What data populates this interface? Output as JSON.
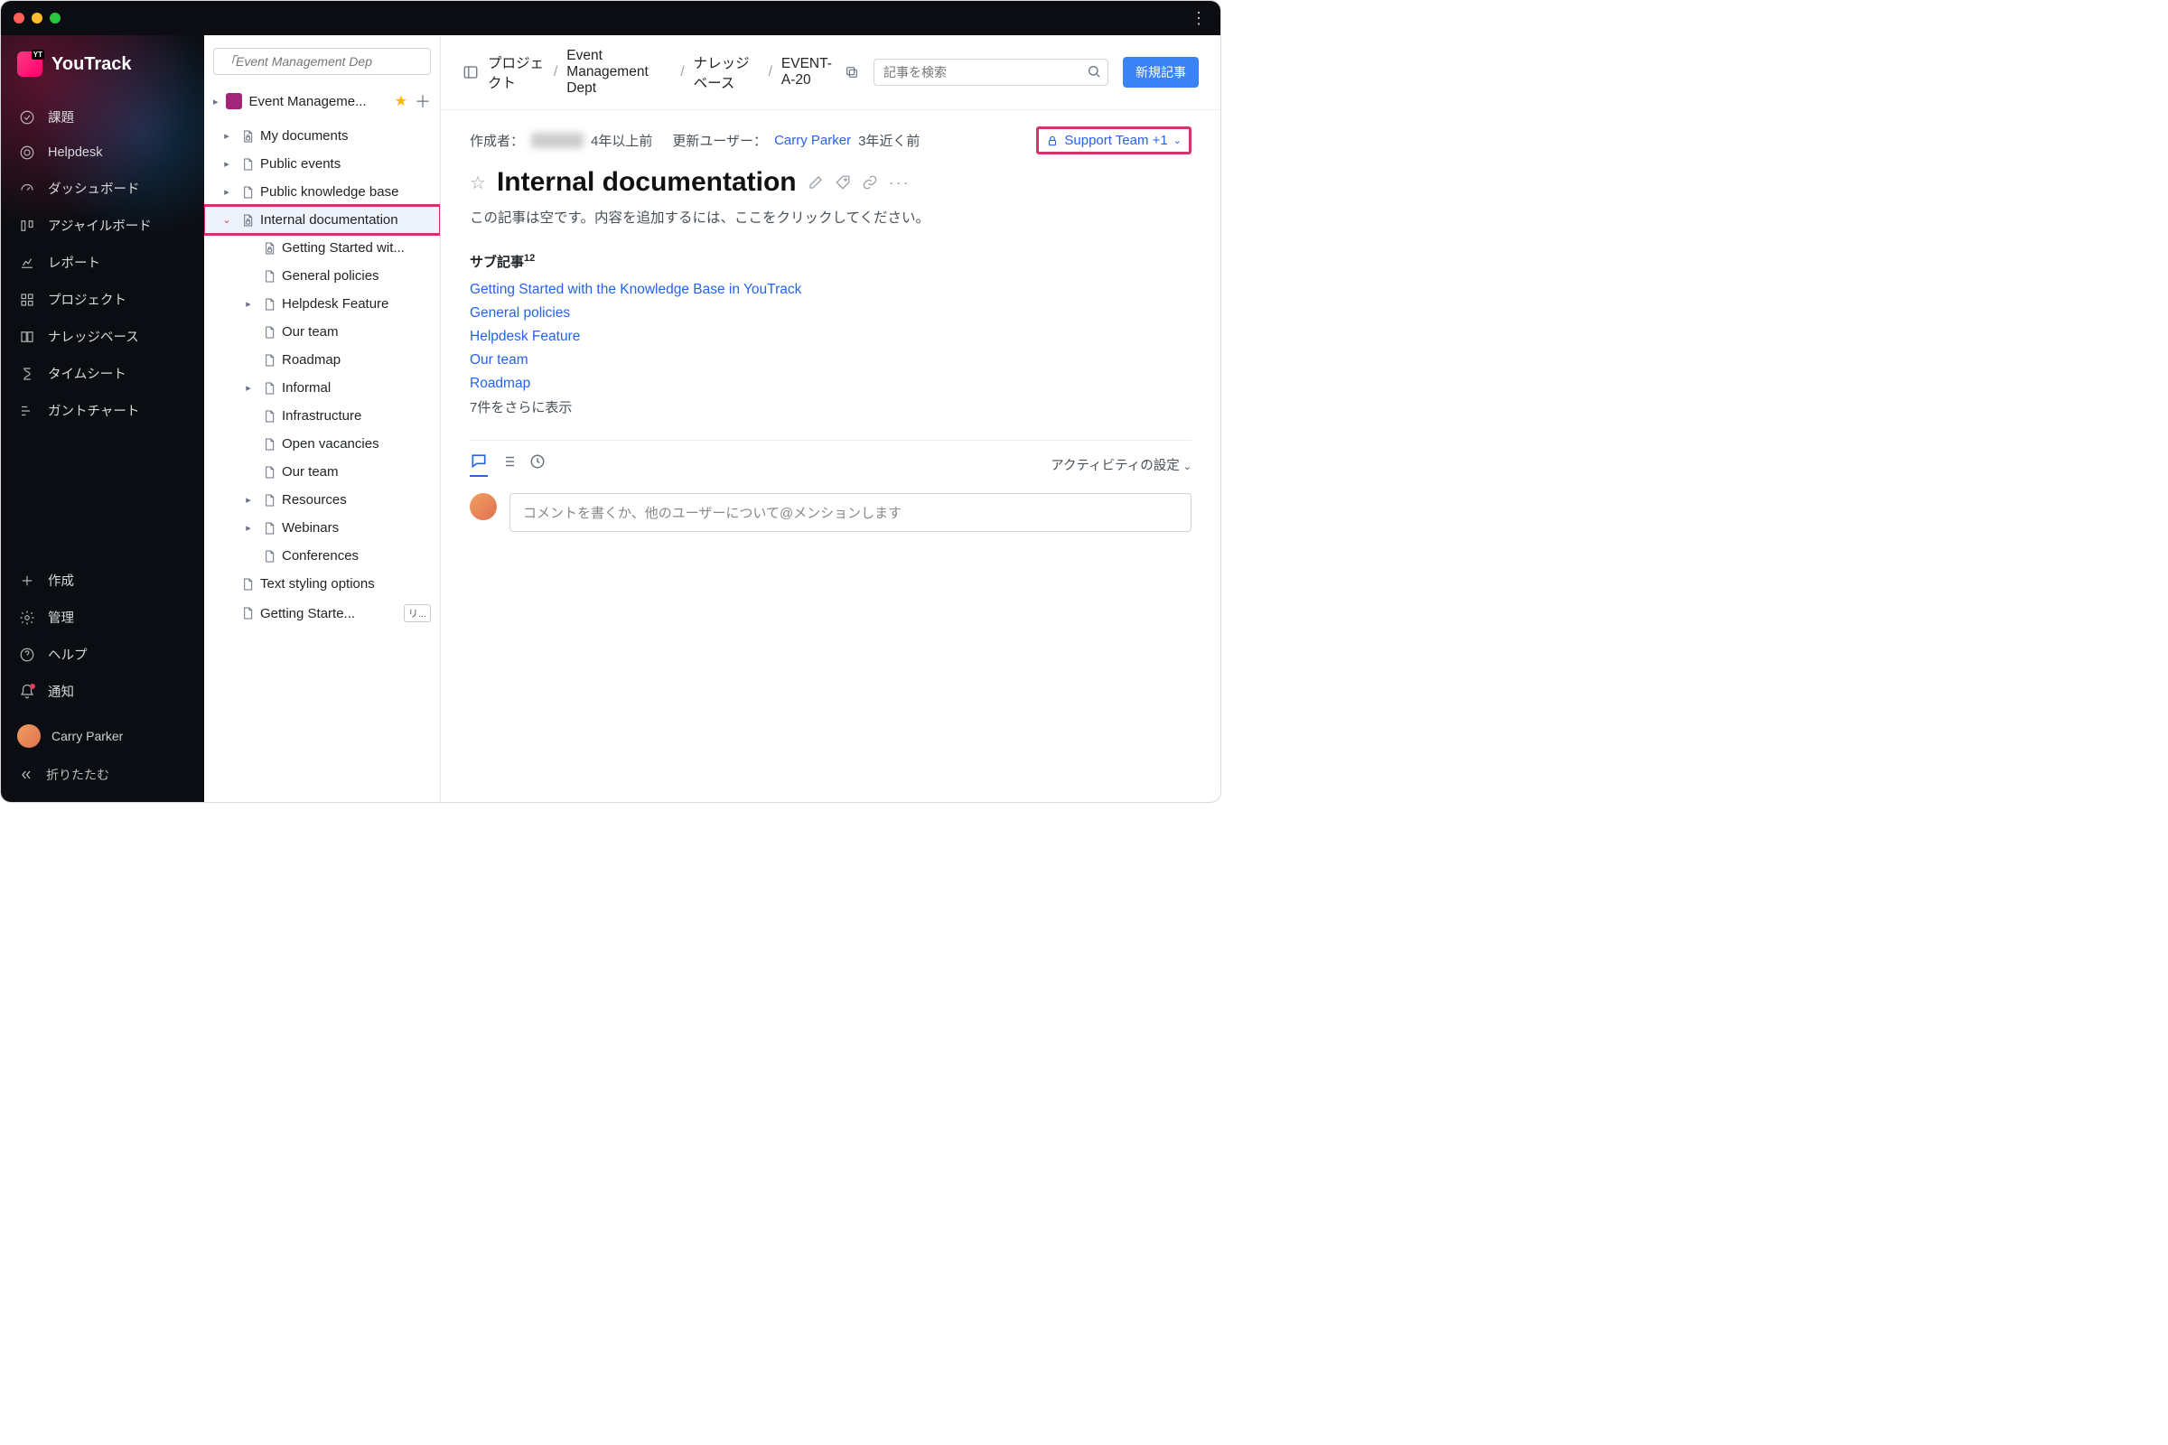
{
  "app": {
    "name": "YouTrack"
  },
  "sidebar": {
    "items": [
      {
        "label": "課題"
      },
      {
        "label": "Helpdesk"
      },
      {
        "label": "ダッシュボード"
      },
      {
        "label": "アジャイルボード"
      },
      {
        "label": "レポート"
      },
      {
        "label": "プロジェクト"
      },
      {
        "label": "ナレッジベース"
      },
      {
        "label": "タイムシート"
      },
      {
        "label": "ガントチャート"
      }
    ],
    "bottom": [
      {
        "label": "作成"
      },
      {
        "label": "管理"
      },
      {
        "label": "ヘルプ"
      },
      {
        "label": "通知"
      }
    ],
    "user": "Carry Parker",
    "collapse": "折りたたむ"
  },
  "tree": {
    "search_placeholder": "「Event Management Dep",
    "project": "Event Manageme...",
    "items": [
      {
        "label": "My documents",
        "depth": 1,
        "children": true,
        "lock": true
      },
      {
        "label": "Public events",
        "depth": 1,
        "children": true,
        "lock": false
      },
      {
        "label": "Public knowledge base",
        "depth": 1,
        "children": true,
        "lock": false
      },
      {
        "label": "Internal documentation",
        "depth": 1,
        "children": true,
        "lock": true,
        "selected": true,
        "open": true
      },
      {
        "label": "Getting Started wit...",
        "depth": 2,
        "children": false,
        "lock": true
      },
      {
        "label": "General policies",
        "depth": 2,
        "children": false,
        "lock": false
      },
      {
        "label": "Helpdesk Feature",
        "depth": 2,
        "children": true,
        "lock": false
      },
      {
        "label": "Our team",
        "depth": 2,
        "children": false,
        "lock": false
      },
      {
        "label": "Roadmap",
        "depth": 2,
        "children": false,
        "lock": false
      },
      {
        "label": "Informal",
        "depth": 2,
        "children": true,
        "lock": false
      },
      {
        "label": "Infrastructure",
        "depth": 2,
        "children": false,
        "lock": false
      },
      {
        "label": "Open vacancies",
        "depth": 2,
        "children": false,
        "lock": false
      },
      {
        "label": "Our team",
        "depth": 2,
        "children": false,
        "lock": false
      },
      {
        "label": "Resources",
        "depth": 2,
        "children": true,
        "lock": false
      },
      {
        "label": "Webinars",
        "depth": 2,
        "children": true,
        "lock": false
      },
      {
        "label": "Conferences",
        "depth": 2,
        "children": false,
        "lock": false
      },
      {
        "label": "Text styling options",
        "depth": 1,
        "children": false,
        "lock": false
      },
      {
        "label": "Getting Starte...",
        "depth": 1,
        "children": false,
        "lock": false,
        "badge": "リ..."
      }
    ]
  },
  "breadcrumb": {
    "root": "プロジェクト",
    "project": "Event Management Dept",
    "section": "ナレッジベース",
    "id": "EVENT-A-20"
  },
  "header": {
    "search_placeholder": "記事を検索",
    "new_button": "新規記事"
  },
  "article": {
    "author_label": "作成者：",
    "created_ago": "4年以上前",
    "updated_label": "更新ユーザー：",
    "updated_by": "Carry Parker",
    "updated_ago": "3年近く前",
    "visibility": "Support Team +1",
    "title": "Internal documentation",
    "empty_hint": "この記事は空です。内容を追加するには、ここをクリックしてください。",
    "sub_label": "サブ記事",
    "sub_count": "12",
    "subs": [
      "Getting Started with the Knowledge Base in YouTrack",
      "General policies",
      "Helpdesk Feature",
      "Our team",
      "Roadmap"
    ],
    "show_more": "7件をさらに表示",
    "activity_settings": "アクティビティの設定",
    "comment_placeholder": "コメントを書くか、他のユーザーについて@メンションします"
  }
}
